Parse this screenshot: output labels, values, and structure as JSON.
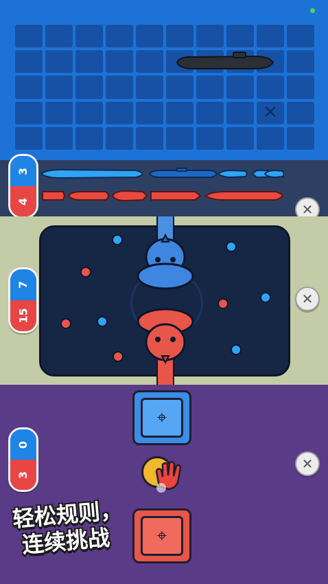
{
  "grid": {
    "rows": 5,
    "cols": 10,
    "miss_mark": "✕"
  },
  "fleet_scores": {
    "blue": "3",
    "red": "4"
  },
  "board_scores": {
    "blue": "7",
    "red": "15"
  },
  "safe_scores": {
    "blue": "0",
    "red": "3"
  },
  "close_icon_glyph": "✕",
  "safe_icon_glyph": "⌖",
  "slogan": {
    "line1": "轻松规则，",
    "line2": "连续挑战"
  },
  "colors": {
    "blue": "#1e84e6",
    "red": "#e84545",
    "purple": "#5a3b87",
    "board": "#162746"
  }
}
